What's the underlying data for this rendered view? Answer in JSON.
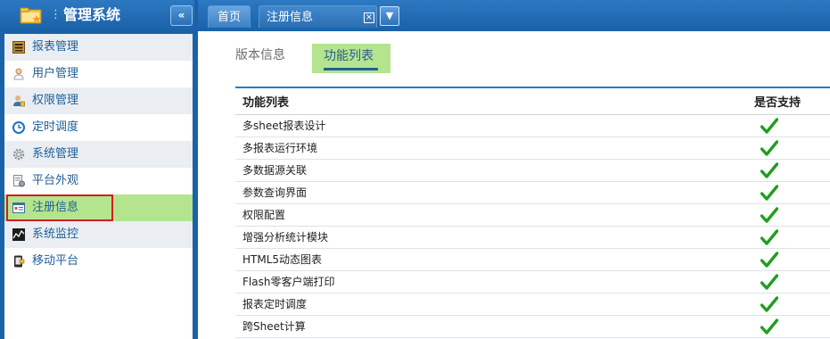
{
  "sidebar": {
    "title": "管理系统",
    "collapse_glyph": "«",
    "dots_glyph": "⋮",
    "items": [
      {
        "label": "报表管理",
        "icon": "report-icon"
      },
      {
        "label": "用户管理",
        "icon": "user-icon"
      },
      {
        "label": "权限管理",
        "icon": "permission-icon"
      },
      {
        "label": "定时调度",
        "icon": "clock-icon"
      },
      {
        "label": "系统管理",
        "icon": "gear-icon"
      },
      {
        "label": "平台外观",
        "icon": "appearance-icon"
      },
      {
        "label": "注册信息",
        "icon": "registration-icon",
        "active": true
      },
      {
        "label": "系统监控",
        "icon": "monitor-icon"
      },
      {
        "label": "移动平台",
        "icon": "mobile-icon"
      }
    ]
  },
  "tabs": {
    "home": "首页",
    "registration": "注册信息",
    "close_glyph": "⊠",
    "menu_glyph": "▼"
  },
  "subtabs": {
    "version": "版本信息",
    "features": "功能列表"
  },
  "table": {
    "headers": [
      "功能列表",
      "是否支持"
    ],
    "rows": [
      {
        "name": "多sheet报表设计",
        "supported": true
      },
      {
        "name": "多报表运行环境",
        "supported": true
      },
      {
        "name": "多数据源关联",
        "supported": true
      },
      {
        "name": "参数查询界面",
        "supported": true
      },
      {
        "name": "权限配置",
        "supported": true
      },
      {
        "name": "增强分析统计模块",
        "supported": true
      },
      {
        "name": "HTML5动态图表",
        "supported": true
      },
      {
        "name": "Flash零客户端打印",
        "supported": true
      },
      {
        "name": "报表定时调度",
        "supported": true
      },
      {
        "name": "跨Sheet计算",
        "supported": true
      }
    ]
  },
  "colors": {
    "header_blue": "#1a62a8",
    "active_green": "#b4e48e",
    "check_green": "#1f9e1f",
    "highlight_red": "#d21f1f"
  }
}
